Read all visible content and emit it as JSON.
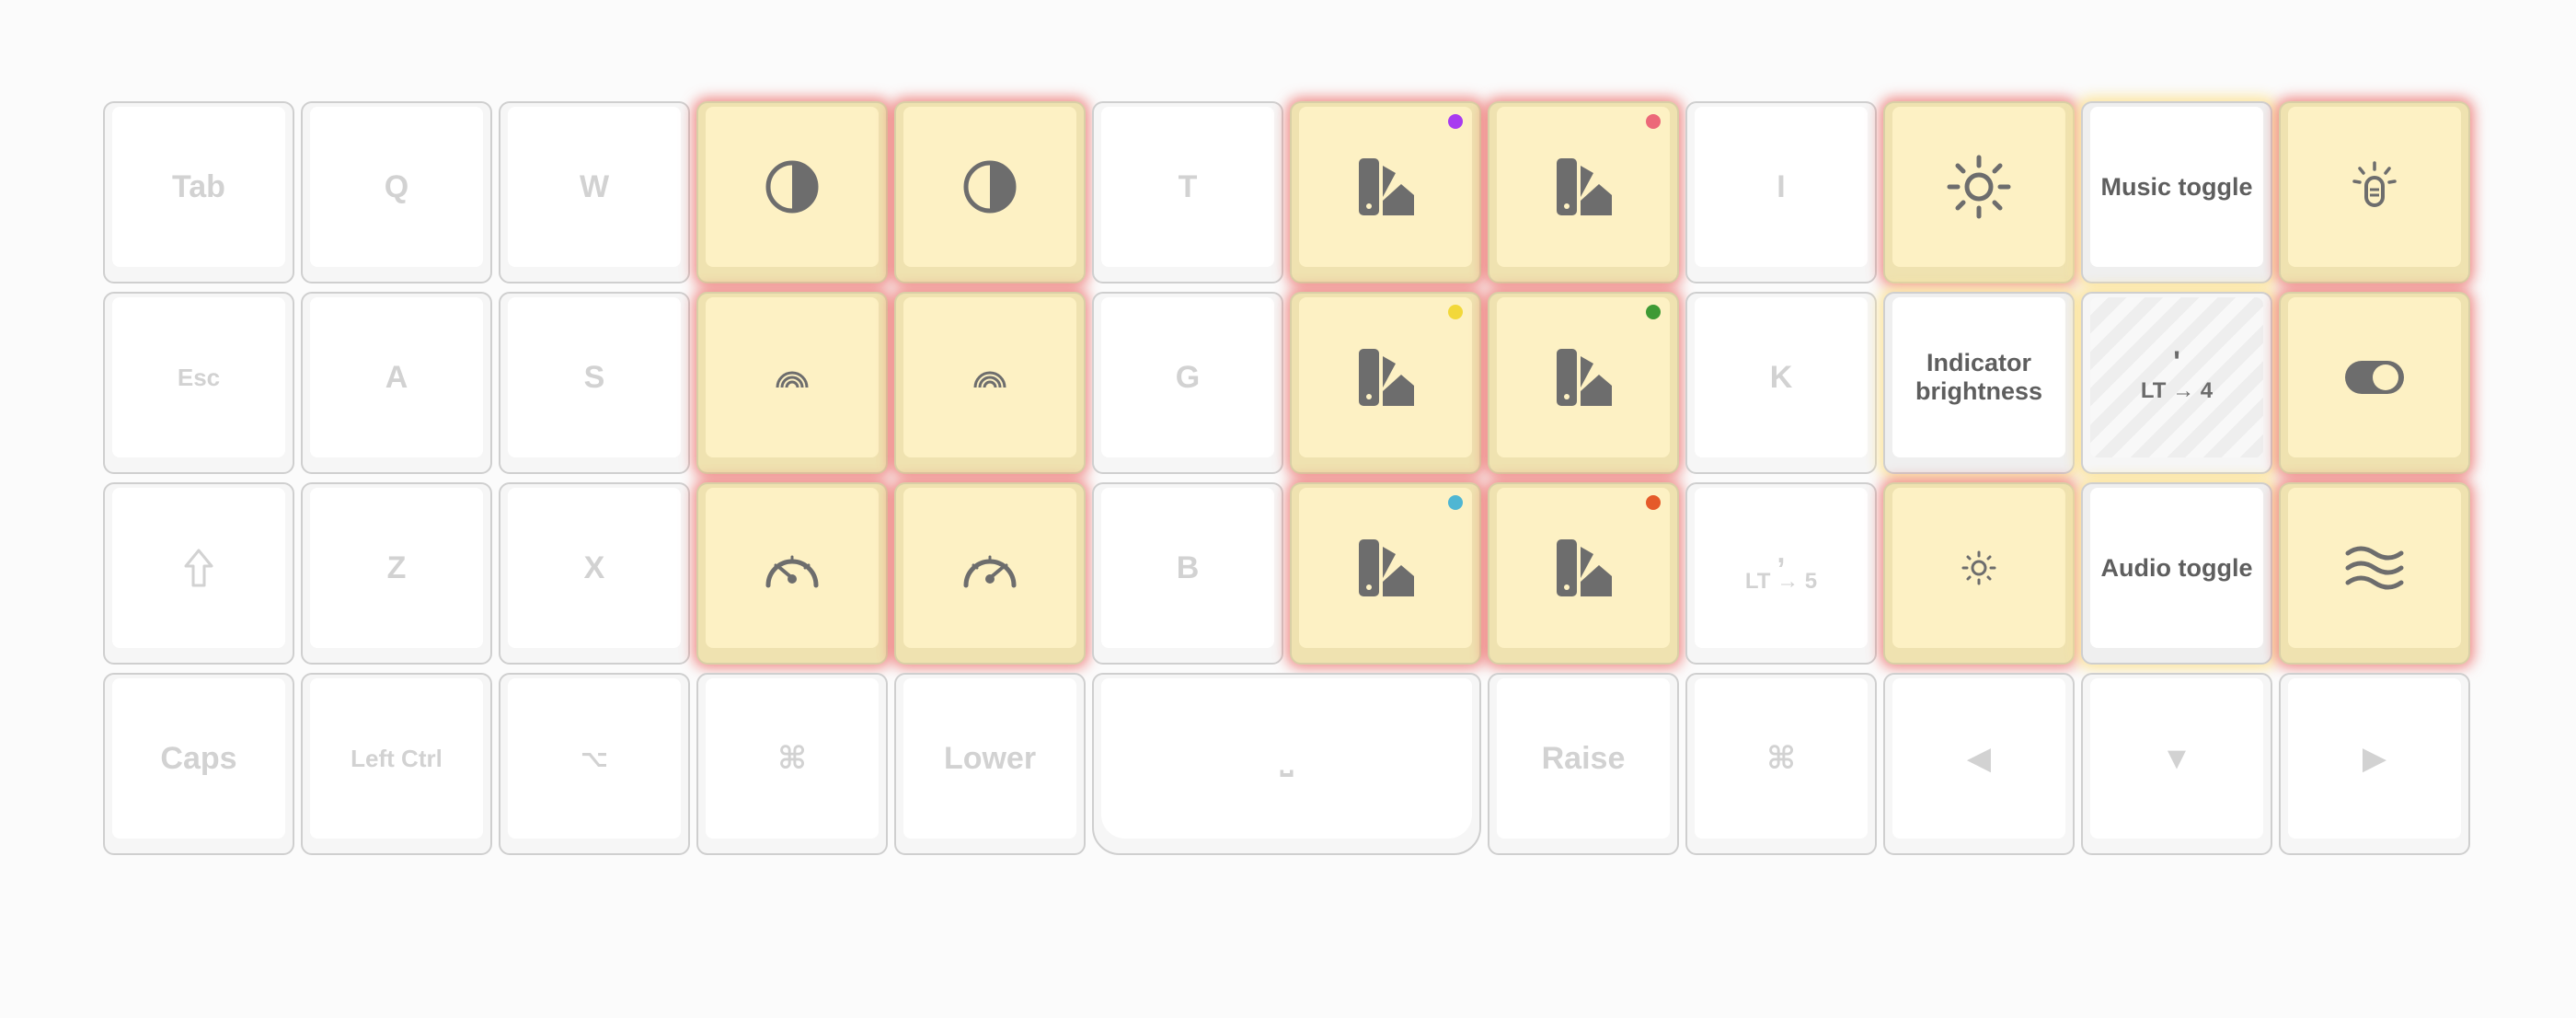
{
  "colors": {
    "active_cap": "#fdf1c4",
    "glow": "#ec6864",
    "icon": "#6d6d6d",
    "faded_text": "#d2d2d2"
  },
  "row1": {
    "k1": "Tab",
    "k2": "Q",
    "k3": "W",
    "k4_icon": "contrast-icon",
    "k5_icon": "contrast-icon",
    "k6": "T",
    "k7_icon": "color-swatch-icon",
    "k7_dot": "#a83bf0",
    "k8_icon": "color-swatch-icon",
    "k8_dot": "#ec6879",
    "k9": "I",
    "k10_icon": "brightness-up-icon",
    "k11": "Music toggle",
    "k12_icon": "backlight-icon"
  },
  "row2": {
    "k1": "Esc",
    "k2": "A",
    "k3": "S",
    "k4_icon": "rainbow-icon",
    "k5_icon": "rainbow-icon",
    "k6": "G",
    "k7_icon": "color-swatch-icon",
    "k7_dot": "#f2d83a",
    "k8_icon": "color-swatch-icon",
    "k8_dot": "#3e9a35",
    "k9": "K",
    "k10": "Indicator brightness",
    "k11_top": "'",
    "k11_bottom": "LT → 4",
    "k12_icon": "toggle-switch-icon"
  },
  "row3": {
    "k1_icon": "shift-arrow-icon",
    "k2": "Z",
    "k3": "X",
    "k4_icon": "speedometer-icon",
    "k5_icon": "speedometer-icon",
    "k6": "B",
    "k7_icon": "color-swatch-icon",
    "k7_dot": "#4fb6d3",
    "k8_icon": "color-swatch-icon",
    "k8_dot": "#e55a2a",
    "k9_top": ",",
    "k9_bottom": "LT → 5",
    "k10_icon": "brightness-down-icon",
    "k11": "Audio toggle",
    "k12_icon": "waves-icon"
  },
  "row4": {
    "k1": "Caps",
    "k2": "Left Ctrl",
    "k3": "⌥",
    "k4": "⌘",
    "k5": "Lower",
    "k6": "⎵",
    "k7": "Raise",
    "k8": "⌘",
    "k9": "◀",
    "k10": "▼",
    "k11": "▶"
  }
}
